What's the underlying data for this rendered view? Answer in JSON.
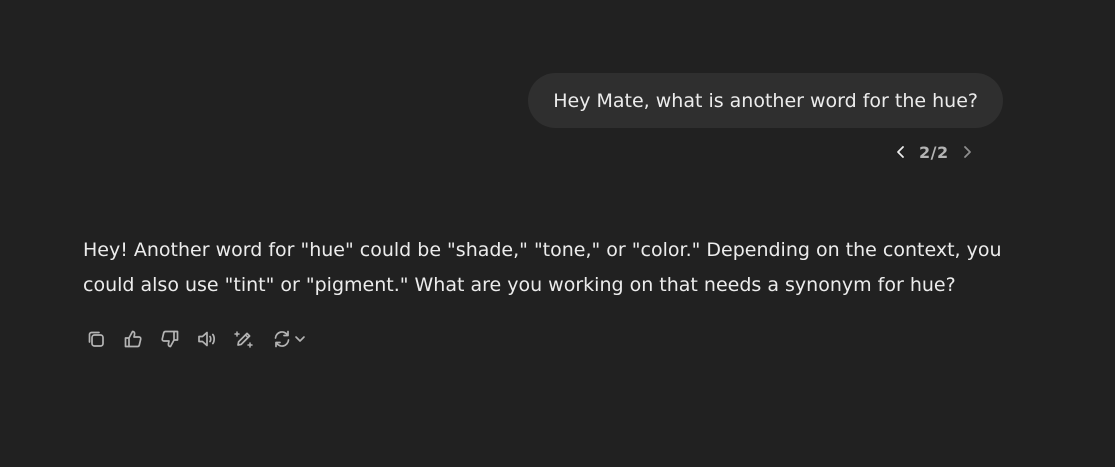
{
  "conversation": {
    "user_message": "Hey Mate, what is another word for the hue?",
    "pager": {
      "current": "2/2",
      "prev_icon": "chevron-left-icon",
      "next_icon": "chevron-right-icon"
    },
    "assistant_message": "Hey! Another word for \"hue\" could be \"shade,\" \"tone,\" or \"color.\" Depending on the context, you could also use \"tint\" or \"pigment.\" What are you working on that needs a synonym for hue?",
    "actions": [
      {
        "icon": "copy-icon"
      },
      {
        "icon": "thumbs-up-icon"
      },
      {
        "icon": "thumbs-down-icon"
      },
      {
        "icon": "read-aloud-icon"
      },
      {
        "icon": "edit-canvas-icon"
      },
      {
        "icon": "regenerate-icon"
      }
    ]
  },
  "colors": {
    "background": "#212121",
    "user_bubble": "#2f2f2f",
    "text": "#ececec",
    "muted": "#b4b4b4"
  }
}
